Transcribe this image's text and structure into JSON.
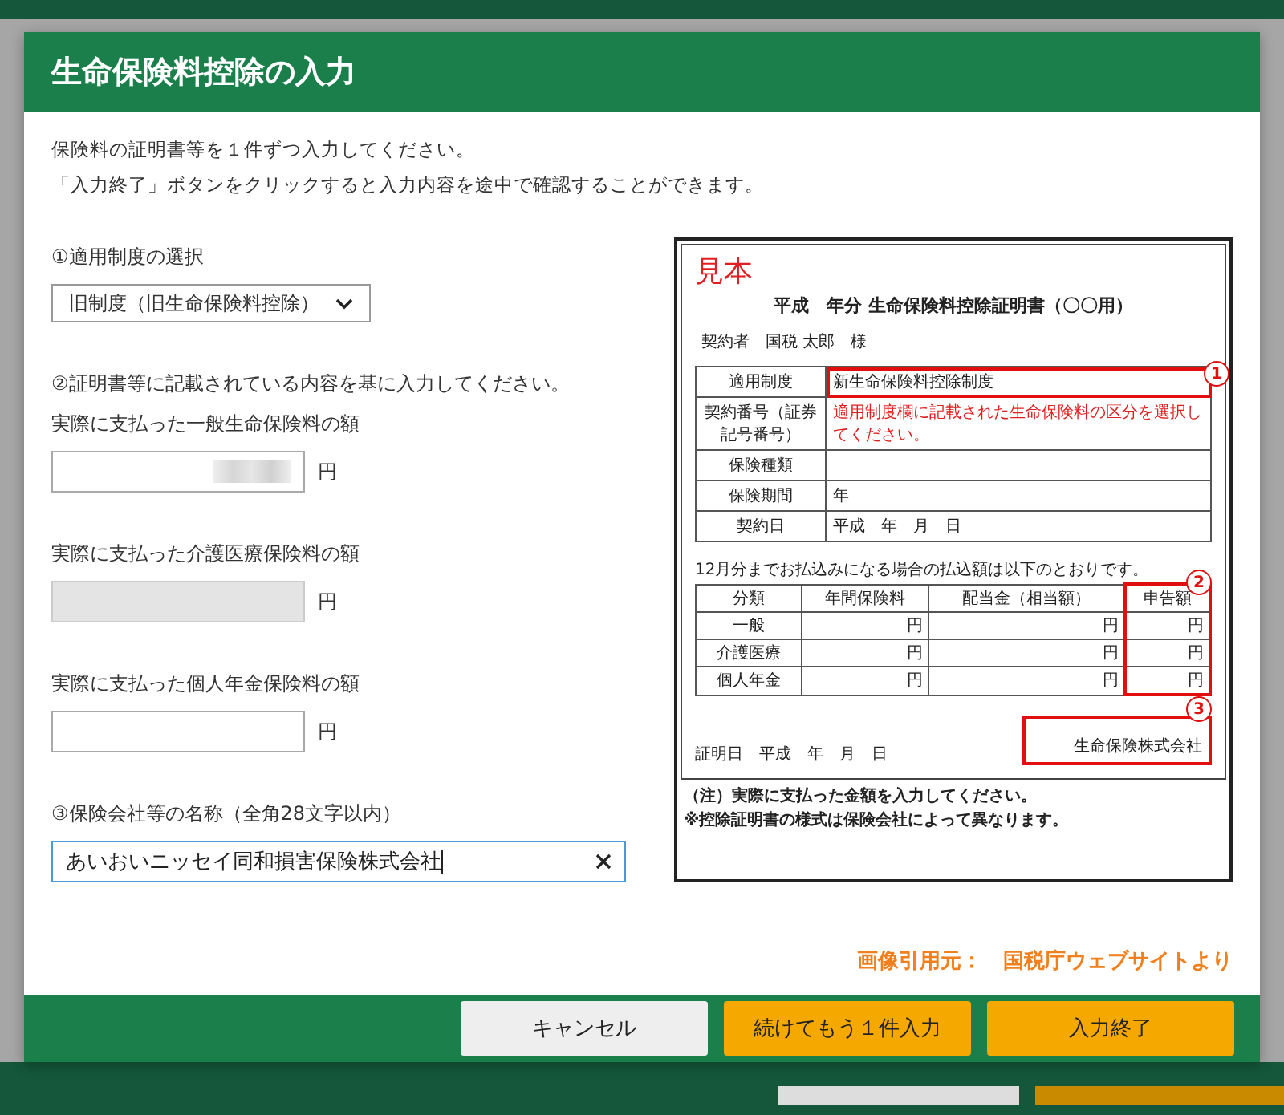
{
  "dialog": {
    "title": "生命保険料控除の入力",
    "intro": [
      "保険料の証明書等を１件ずつ入力してください。",
      "「入力終了」ボタンをクリックすると入力内容を途中で確認することができます。"
    ],
    "system": {
      "label": "①適用制度の選択",
      "value": "旧制度（旧生命保険料控除）"
    },
    "amounts_heading": "②証明書等に記載されている内容を基に入力してください。",
    "amounts": [
      {
        "label": "実際に支払った一般生命保険料の額",
        "redacted": true,
        "disabled": false,
        "unit": "円"
      },
      {
        "label": "実際に支払った介護医療保険料の額",
        "redacted": false,
        "disabled": true,
        "unit": "円"
      },
      {
        "label": "実際に支払った個人年金保険料の額",
        "redacted": false,
        "disabled": false,
        "unit": "円"
      }
    ],
    "company": {
      "label": "③保険会社等の名称（全角28文字以内）",
      "value": "あいおいニッセイ同和損害保険株式会社",
      "focused": true
    },
    "sample": {
      "stamp": "見本",
      "title": "平成　年分 生命保険料控除証明書（〇〇用）",
      "holder": "契約者　国税 太郎　様",
      "rows": [
        {
          "label": "適用制度",
          "value": "新生命保険料控除制度",
          "kind": "highlight",
          "marker": "1"
        },
        {
          "label": "契約番号（証券記号番号）",
          "value": "適用制度欄に記載された生命保険料の区分を選択してください。",
          "kind": "note"
        },
        {
          "label": "保険種類",
          "kind": "plain"
        },
        {
          "label": "保険期間",
          "value": "年",
          "kind": "plain"
        },
        {
          "label": "契約日",
          "value": "平成　年　月　日",
          "kind": "plain"
        }
      ],
      "payment_caption": "12月分までお払込みになる場合の払込額は以下のとおりです。",
      "payment_columns": [
        "分類",
        "年間保険料",
        "配当金（相当額）",
        "申告額"
      ],
      "payment_marker": "2",
      "payment_rows": [
        {
          "label": "一般",
          "cells": [
            "円",
            "円",
            "円"
          ]
        },
        {
          "label": "介護医療",
          "cells": [
            "円",
            "円",
            "円"
          ]
        },
        {
          "label": "個人年金",
          "cells": [
            "円",
            "円",
            "円"
          ]
        }
      ],
      "date": "証明日　平成　年　月　日",
      "issuer": "生命保険株式会社",
      "issuer_marker": "3",
      "notes": [
        "（注）実際に支払った金額を入力してください。",
        "※控除証明書の様式は保険会社によって異なります。"
      ]
    },
    "source": "画像引用元：　国税庁ウェブサイトより",
    "buttons": [
      {
        "label": "キャンセル",
        "kind": "secondary"
      },
      {
        "label": "続けてもう１件入力",
        "kind": "primary"
      },
      {
        "label": "入力終了",
        "kind": "primary"
      }
    ]
  }
}
